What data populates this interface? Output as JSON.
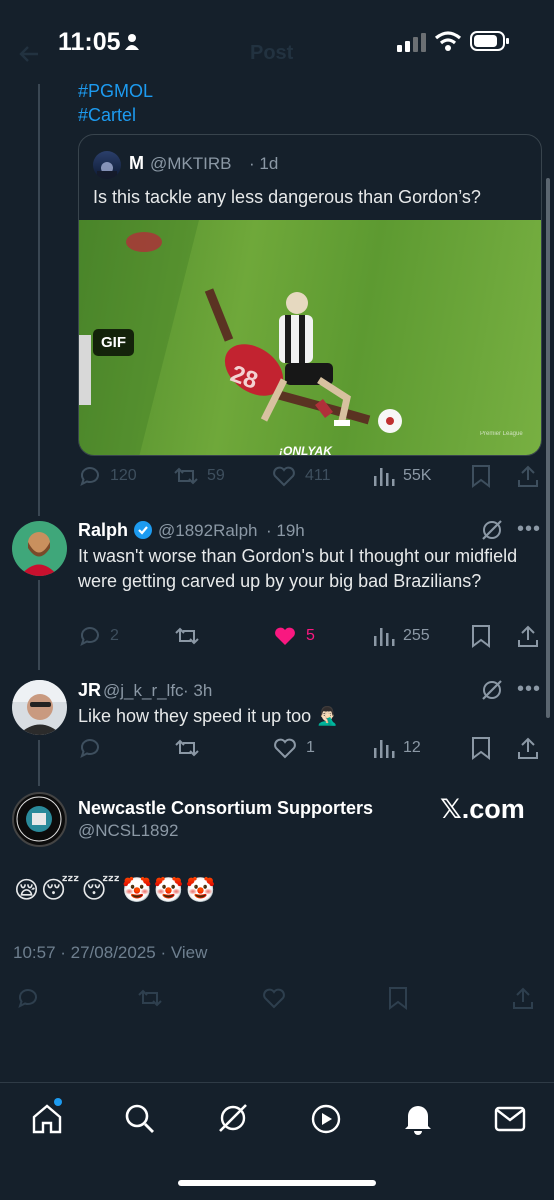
{
  "status_bar": {
    "time": "11:05"
  },
  "header": {
    "title": "Post"
  },
  "main_post_tail": {
    "hashtags": [
      "#PGMOL",
      "#Cartel"
    ]
  },
  "quoted_post": {
    "name": "M",
    "handle": "@MKTIRB",
    "time": "· 1d",
    "text": "Is this tackle any less dangerous than Gordon’s?",
    "media_badge": "GIF",
    "media_watermark": "¡ONLYAK",
    "media_corner_text": "Premier League"
  },
  "main_post_actions": {
    "replies": "120",
    "reposts": "59",
    "likes": "411",
    "views": "55K"
  },
  "replies": [
    {
      "name": "Ralph",
      "handle": "@1892Ralph",
      "time": "· 19h",
      "text": "It wasn't worse than Gordon's but I thought our midfield were getting carved up by your big bad Brazilians?",
      "replies": "2",
      "reposts": "",
      "likes": "5",
      "views": "255",
      "verified": true,
      "liked": true
    },
    {
      "name": "JR",
      "handle": "@j_k_r_lfc",
      "time": "· 3h",
      "text": "Like how they speed it up too 🤦🏻‍♂️",
      "replies": "",
      "reposts": "",
      "likes": "1",
      "views": "12",
      "verified": false,
      "liked": false
    }
  ],
  "new_post": {
    "name": "Newcastle Consortium Supporters",
    "handle": "@NCSL1892",
    "badge": "𝕏.com",
    "text": "😪😴😴🤡🤡🤡",
    "timestamp": "10:57 · 27/08/2025 · View"
  },
  "colors": {
    "background": "#15202b",
    "accent": "#1d9bf0",
    "like": "#f91880"
  },
  "nav": [
    "home-icon",
    "search-icon",
    "grok-icon",
    "video-icon",
    "notifications-icon",
    "messages-icon"
  ]
}
